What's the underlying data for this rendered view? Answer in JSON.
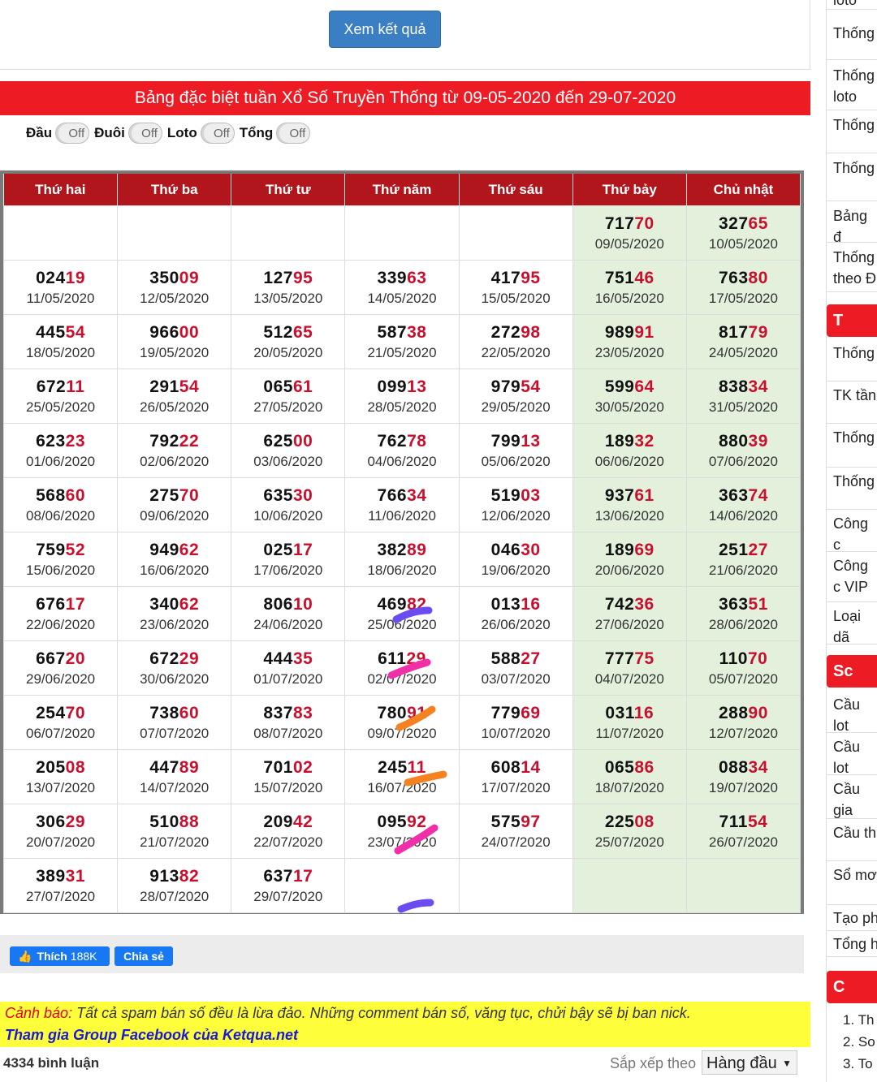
{
  "header": {
    "view_button": "Xem kết quả"
  },
  "banner": {
    "title": "Bảng đặc biệt tuần Xổ Số Truyền Thống từ 09-05-2020 đến 29-07-2020"
  },
  "toggles": [
    {
      "label": "Đầu",
      "state": "Off"
    },
    {
      "label": "Đuôi",
      "state": "Off"
    },
    {
      "label": "Loto",
      "state": "Off"
    },
    {
      "label": "Tổng",
      "state": "Off"
    }
  ],
  "table": {
    "headers": [
      "Thứ hai",
      "Thứ ba",
      "Thứ tư",
      "Thứ năm",
      "Thứ sáu",
      "Thứ bảy",
      "Chủ nhật"
    ],
    "rows": [
      [
        {
          "h": "",
          "t": "",
          "d": ""
        },
        {
          "h": "",
          "t": "",
          "d": ""
        },
        {
          "h": "",
          "t": "",
          "d": ""
        },
        {
          "h": "",
          "t": "",
          "d": ""
        },
        {
          "h": "",
          "t": "",
          "d": ""
        },
        {
          "h": "717",
          "t": "70",
          "d": "09/05/2020"
        },
        {
          "h": "327",
          "t": "65",
          "d": "10/05/2020"
        }
      ],
      [
        {
          "h": "024",
          "t": "19",
          "d": "11/05/2020"
        },
        {
          "h": "350",
          "t": "09",
          "d": "12/05/2020"
        },
        {
          "h": "127",
          "t": "95",
          "d": "13/05/2020"
        },
        {
          "h": "339",
          "t": "63",
          "d": "14/05/2020"
        },
        {
          "h": "417",
          "t": "95",
          "d": "15/05/2020"
        },
        {
          "h": "751",
          "t": "46",
          "d": "16/05/2020"
        },
        {
          "h": "763",
          "t": "80",
          "d": "17/05/2020"
        }
      ],
      [
        {
          "h": "445",
          "t": "54",
          "d": "18/05/2020"
        },
        {
          "h": "966",
          "t": "00",
          "d": "19/05/2020"
        },
        {
          "h": "512",
          "t": "65",
          "d": "20/05/2020"
        },
        {
          "h": "587",
          "t": "38",
          "d": "21/05/2020"
        },
        {
          "h": "272",
          "t": "98",
          "d": "22/05/2020"
        },
        {
          "h": "989",
          "t": "91",
          "d": "23/05/2020"
        },
        {
          "h": "817",
          "t": "79",
          "d": "24/05/2020"
        }
      ],
      [
        {
          "h": "672",
          "t": "11",
          "d": "25/05/2020"
        },
        {
          "h": "291",
          "t": "54",
          "d": "26/05/2020"
        },
        {
          "h": "065",
          "t": "61",
          "d": "27/05/2020"
        },
        {
          "h": "099",
          "t": "13",
          "d": "28/05/2020"
        },
        {
          "h": "979",
          "t": "54",
          "d": "29/05/2020"
        },
        {
          "h": "599",
          "t": "64",
          "d": "30/05/2020"
        },
        {
          "h": "838",
          "t": "34",
          "d": "31/05/2020"
        }
      ],
      [
        {
          "h": "623",
          "t": "23",
          "d": "01/06/2020"
        },
        {
          "h": "792",
          "t": "22",
          "d": "02/06/2020"
        },
        {
          "h": "625",
          "t": "00",
          "d": "03/06/2020"
        },
        {
          "h": "762",
          "t": "78",
          "d": "04/06/2020"
        },
        {
          "h": "799",
          "t": "13",
          "d": "05/06/2020"
        },
        {
          "h": "189",
          "t": "32",
          "d": "06/06/2020"
        },
        {
          "h": "880",
          "t": "39",
          "d": "07/06/2020"
        }
      ],
      [
        {
          "h": "568",
          "t": "60",
          "d": "08/06/2020"
        },
        {
          "h": "275",
          "t": "70",
          "d": "09/06/2020"
        },
        {
          "h": "635",
          "t": "30",
          "d": "10/06/2020"
        },
        {
          "h": "766",
          "t": "34",
          "d": "11/06/2020"
        },
        {
          "h": "519",
          "t": "03",
          "d": "12/06/2020"
        },
        {
          "h": "937",
          "t": "61",
          "d": "13/06/2020"
        },
        {
          "h": "363",
          "t": "74",
          "d": "14/06/2020"
        }
      ],
      [
        {
          "h": "759",
          "t": "52",
          "d": "15/06/2020"
        },
        {
          "h": "949",
          "t": "62",
          "d": "16/06/2020"
        },
        {
          "h": "025",
          "t": "17",
          "d": "17/06/2020"
        },
        {
          "h": "382",
          "t": "89",
          "d": "18/06/2020"
        },
        {
          "h": "046",
          "t": "30",
          "d": "19/06/2020"
        },
        {
          "h": "189",
          "t": "69",
          "d": "20/06/2020"
        },
        {
          "h": "251",
          "t": "27",
          "d": "21/06/2020"
        }
      ],
      [
        {
          "h": "676",
          "t": "17",
          "d": "22/06/2020"
        },
        {
          "h": "340",
          "t": "62",
          "d": "23/06/2020"
        },
        {
          "h": "806",
          "t": "10",
          "d": "24/06/2020"
        },
        {
          "h": "469",
          "t": "82",
          "d": "25/06/2020"
        },
        {
          "h": "013",
          "t": "16",
          "d": "26/06/2020"
        },
        {
          "h": "742",
          "t": "36",
          "d": "27/06/2020"
        },
        {
          "h": "363",
          "t": "51",
          "d": "28/06/2020"
        }
      ],
      [
        {
          "h": "667",
          "t": "20",
          "d": "29/06/2020"
        },
        {
          "h": "672",
          "t": "29",
          "d": "30/06/2020"
        },
        {
          "h": "444",
          "t": "35",
          "d": "01/07/2020"
        },
        {
          "h": "611",
          "t": "29",
          "d": "02/07/2020"
        },
        {
          "h": "588",
          "t": "27",
          "d": "03/07/2020"
        },
        {
          "h": "777",
          "t": "75",
          "d": "04/07/2020"
        },
        {
          "h": "110",
          "t": "70",
          "d": "05/07/2020"
        }
      ],
      [
        {
          "h": "254",
          "t": "70",
          "d": "06/07/2020"
        },
        {
          "h": "738",
          "t": "60",
          "d": "07/07/2020"
        },
        {
          "h": "837",
          "t": "83",
          "d": "08/07/2020"
        },
        {
          "h": "780",
          "t": "91",
          "d": "09/07/2020"
        },
        {
          "h": "779",
          "t": "69",
          "d": "10/07/2020"
        },
        {
          "h": "031",
          "t": "16",
          "d": "11/07/2020"
        },
        {
          "h": "288",
          "t": "90",
          "d": "12/07/2020"
        }
      ],
      [
        {
          "h": "205",
          "t": "08",
          "d": "13/07/2020"
        },
        {
          "h": "447",
          "t": "89",
          "d": "14/07/2020"
        },
        {
          "h": "701",
          "t": "02",
          "d": "15/07/2020"
        },
        {
          "h": "245",
          "t": "11",
          "d": "16/07/2020"
        },
        {
          "h": "608",
          "t": "14",
          "d": "17/07/2020"
        },
        {
          "h": "065",
          "t": "86",
          "d": "18/07/2020"
        },
        {
          "h": "088",
          "t": "34",
          "d": "19/07/2020"
        }
      ],
      [
        {
          "h": "306",
          "t": "29",
          "d": "20/07/2020"
        },
        {
          "h": "510",
          "t": "88",
          "d": "21/07/2020"
        },
        {
          "h": "209",
          "t": "42",
          "d": "22/07/2020"
        },
        {
          "h": "095",
          "t": "92",
          "d": "23/07/2020"
        },
        {
          "h": "575",
          "t": "97",
          "d": "24/07/2020"
        },
        {
          "h": "225",
          "t": "08",
          "d": "25/07/2020"
        },
        {
          "h": "711",
          "t": "54",
          "d": "26/07/2020"
        }
      ],
      [
        {
          "h": "389",
          "t": "31",
          "d": "27/07/2020"
        },
        {
          "h": "913",
          "t": "82",
          "d": "28/07/2020"
        },
        {
          "h": "637",
          "t": "17",
          "d": "29/07/2020"
        },
        {
          "h": "",
          "t": "",
          "d": ""
        },
        {
          "h": "",
          "t": "",
          "d": ""
        },
        {
          "h": "",
          "t": "",
          "d": ""
        },
        {
          "h": "",
          "t": "",
          "d": ""
        }
      ]
    ]
  },
  "social": {
    "like_label": "Thích",
    "like_count": "188K",
    "share_label": "Chia sẻ"
  },
  "warning": {
    "prefix": "Cảnh báo:",
    "text": " Tất cả spam bán số đều là lừa đảo. Những comment bán số, văng tục, chửi bậy sẽ bị ban nick.",
    "link": "Tham gia Group Facebook của Ketqua.net"
  },
  "comments": {
    "count": "4334 bình luận",
    "sort_label": "Sắp xếp theo",
    "sort_value": "Hàng đầu"
  },
  "annotation_colors": [
    "#6a4cf0",
    "#f02fa8",
    "#f58220"
  ],
  "sidebar": {
    "items_top": [
      "loto",
      "Thống",
      "Thống loto",
      "Thống",
      "Thống",
      "Bảng đ",
      "Thống theo Đ"
    ],
    "head1": "T",
    "items_mid": [
      "Thống",
      "TK tần",
      "Thống",
      "Thống",
      "Công c",
      "Công c VIP",
      "Loại dã"
    ],
    "head2": "Sc",
    "items_low": [
      "Cầu lot",
      "Cầu lot",
      "Cầu gia",
      "Cầu th",
      "Sổ mơ",
      "Tạo ph",
      "Tổng h"
    ],
    "head3": "C",
    "ol": [
      "1. Th",
      "2. So",
      "3. To"
    ]
  }
}
